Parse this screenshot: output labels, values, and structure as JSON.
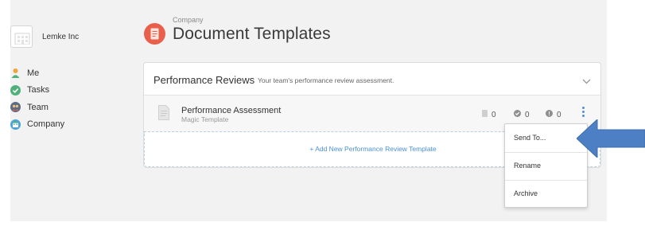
{
  "org": {
    "name": "Lemke Inc"
  },
  "nav": {
    "items": [
      {
        "label": "Me",
        "icon": "person-icon",
        "color": "#f0a43b"
      },
      {
        "label": "Tasks",
        "icon": "check-circle-icon",
        "color": "#4fb07a"
      },
      {
        "label": "Team",
        "icon": "team-icon",
        "color": "#5b6d84"
      },
      {
        "label": "Company",
        "icon": "company-icon",
        "color": "#4ba3d8"
      }
    ]
  },
  "header": {
    "subtitle": "Company",
    "title": "Document Templates",
    "icon": "document-icon",
    "icon_color": "#e8604c"
  },
  "panel": {
    "title": "Performance Reviews",
    "description": "Your team's performance review assessment.",
    "template": {
      "name": "Performance Assessment",
      "type": "Magic Template",
      "stats": [
        {
          "icon": "document-count-icon",
          "value": "0"
        },
        {
          "icon": "check-count-icon",
          "value": "0"
        },
        {
          "icon": "alert-count-icon",
          "value": "0"
        }
      ]
    },
    "add_label": "+ Add New Performance Review Template"
  },
  "menu": {
    "items": [
      {
        "label": "Send To..."
      },
      {
        "label": "Rename"
      },
      {
        "label": "Archive"
      }
    ]
  },
  "colors": {
    "accent": "#4a90d9",
    "arrow": "#4c7fc4",
    "background": "#f2f2f2"
  }
}
